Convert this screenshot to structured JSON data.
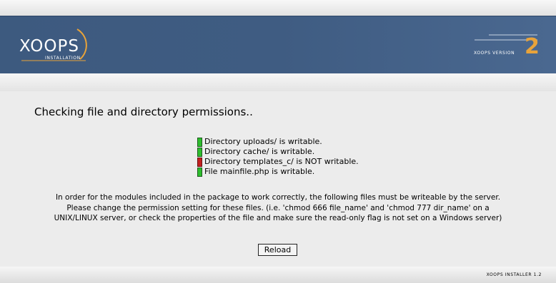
{
  "header": {
    "logo_text": "XOOPS",
    "logo_subtext": "INSTALLATION",
    "version_label": "XOOPS VERSION",
    "version_number": "2"
  },
  "main": {
    "title": "Checking file and directory permissions..",
    "checks": [
      {
        "text": "Directory uploads/ is writable.",
        "status": "ok"
      },
      {
        "text": "Directory cache/ is writable.",
        "status": "ok"
      },
      {
        "text": "Directory templates_c/ is NOT writable.",
        "status": "error"
      },
      {
        "text": "File mainfile.php is writable.",
        "status": "ok"
      }
    ],
    "notice_lines": [
      "In order for the modules included in the package to work correctly, the following files must be writeable by the server.",
      "Please change the permission setting for these files. (i.e. 'chmod 666 file_name' and 'chmod 777 dir_name' on a",
      "UNIX/LINUX server, or check the properties of the file and make sure the read-only flag is not set on a Windows server)"
    ],
    "reload_label": "Reload"
  },
  "footer": {
    "text": "XOOPS INSTALLER 1.2"
  },
  "colors": {
    "header_bg": "#3f5c82",
    "accent_orange": "#e8a33a",
    "status_ok": "#2dbd2d",
    "status_error": "#c22020"
  }
}
